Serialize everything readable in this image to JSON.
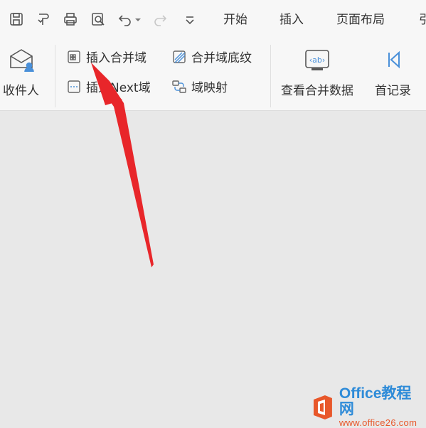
{
  "quick_access": {
    "icons": [
      "save-icon",
      "format-painter-icon",
      "print-icon",
      "print-preview-icon",
      "undo-icon",
      "redo-icon",
      "customize-dropdown-icon"
    ]
  },
  "menu": {
    "tabs": [
      "开始",
      "插入",
      "页面布局",
      "引"
    ]
  },
  "ribbon": {
    "recipients_label": "收件人",
    "insert_merge_field_label": "插入合并域",
    "insert_next_field_label": "插入Next域",
    "merge_field_shading_label": "合并域底纹",
    "field_mapping_label": "域映射",
    "view_merged_data_label": "查看合并数据",
    "view_merged_data_icon_text": "‹ab›",
    "first_record_label": "首记录"
  },
  "watermark": {
    "line1": "Office教程网",
    "line2": "www.office26.com"
  },
  "colors": {
    "accent_blue": "#2e8bd8",
    "arrow_red": "#e8262a",
    "watermark_orange": "#e8572a"
  }
}
